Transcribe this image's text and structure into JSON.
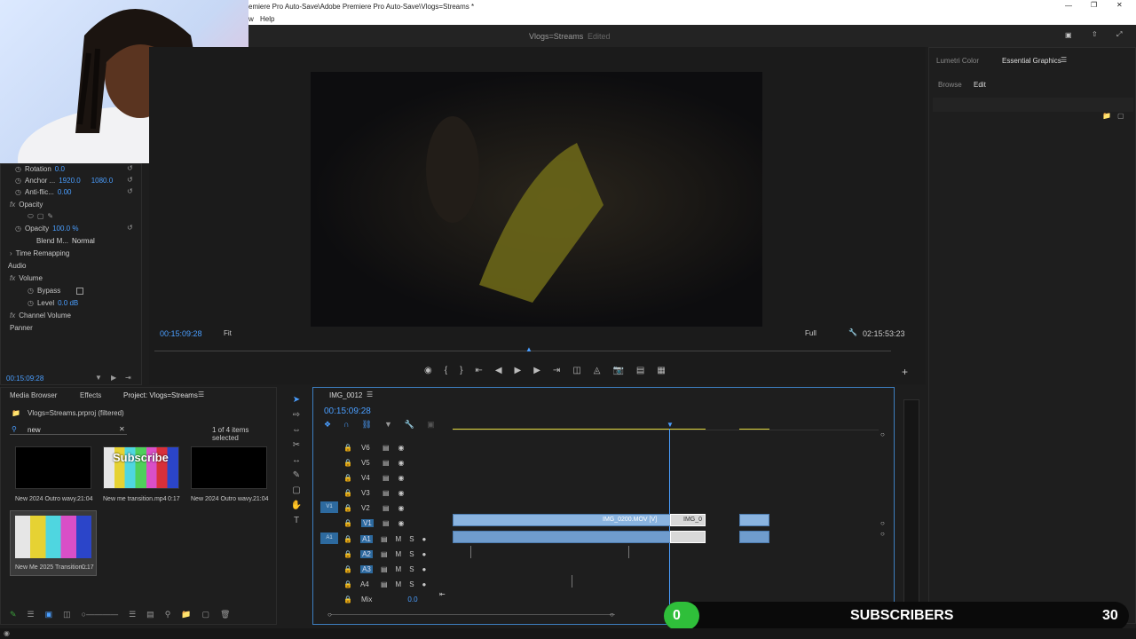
{
  "titlebar": {
    "title": "emiere Pro Auto-Save\\Adobe Premiere Pro Auto-Save\\Vlogs=Streams *"
  },
  "menu": {
    "help": "Help",
    "w": "w"
  },
  "app": {
    "sequence": "Vlogs=Streams",
    "status": "Edited"
  },
  "effects": {
    "rotation": {
      "label": "Rotation",
      "value": "0.0"
    },
    "anchor": {
      "label": "Anchor ...",
      "x": "1920.0",
      "y": "1080.0"
    },
    "antiflicker": {
      "label": "Anti-flic...",
      "value": "0.00"
    },
    "opacity_section": "Opacity",
    "opacity": {
      "label": "Opacity",
      "value": "100.0 %"
    },
    "blend": {
      "label": "Blend M...",
      "value": "Normal"
    },
    "time_remap": "Time Remapping",
    "audio": "Audio",
    "volume": "Volume",
    "bypass": "Bypass",
    "level": {
      "label": "Level",
      "value": "0.0 dB"
    },
    "channel_volume": "Channel Volume",
    "panner": "Panner",
    "timecode": "00:15:09:28"
  },
  "program": {
    "timecode": "00:15:09:28",
    "fit": "Fit",
    "quality": "Full",
    "duration": "02:15:53:23"
  },
  "right_panel": {
    "lumetri": "Lumetri Color",
    "essential": "Essential Graphics",
    "browse": "Browse",
    "edit": "Edit"
  },
  "project": {
    "tabs": [
      "Media Browser",
      "Effects",
      "Project: Vlogs=Streams"
    ],
    "file": "Vlogs=Streams.prproj (filtered)",
    "search": "new",
    "selected": "1 of 4 items selected",
    "items": [
      {
        "name": "New 2024 Outro wavy...",
        "dur": "21:04"
      },
      {
        "name": "New me transition.mp4",
        "dur": "0:17"
      },
      {
        "name": "New 2024 Outro wavy...",
        "dur": "21:04"
      },
      {
        "name": "New Me 2025 Transition...",
        "dur": "0:17"
      }
    ],
    "thumb_text": "Subscribe"
  },
  "timeline": {
    "tab": "IMG_0012",
    "timecode": "00:15:09:28",
    "video_tracks": [
      "V6",
      "V5",
      "V4",
      "V3",
      "V2",
      "V1"
    ],
    "audio_tracks": [
      "A1",
      "A2",
      "A3",
      "A4"
    ],
    "mix": "Mix",
    "mix_value": "0.0",
    "clip_main": "IMG_0200.MOV [V]",
    "clip_side": "IMG_0",
    "m": "M",
    "s": "S",
    "v1_src": "V1",
    "a1_src": "A1"
  },
  "overlay": {
    "count": "0",
    "label": "SUBSCRIBERS",
    "goal": "30"
  }
}
